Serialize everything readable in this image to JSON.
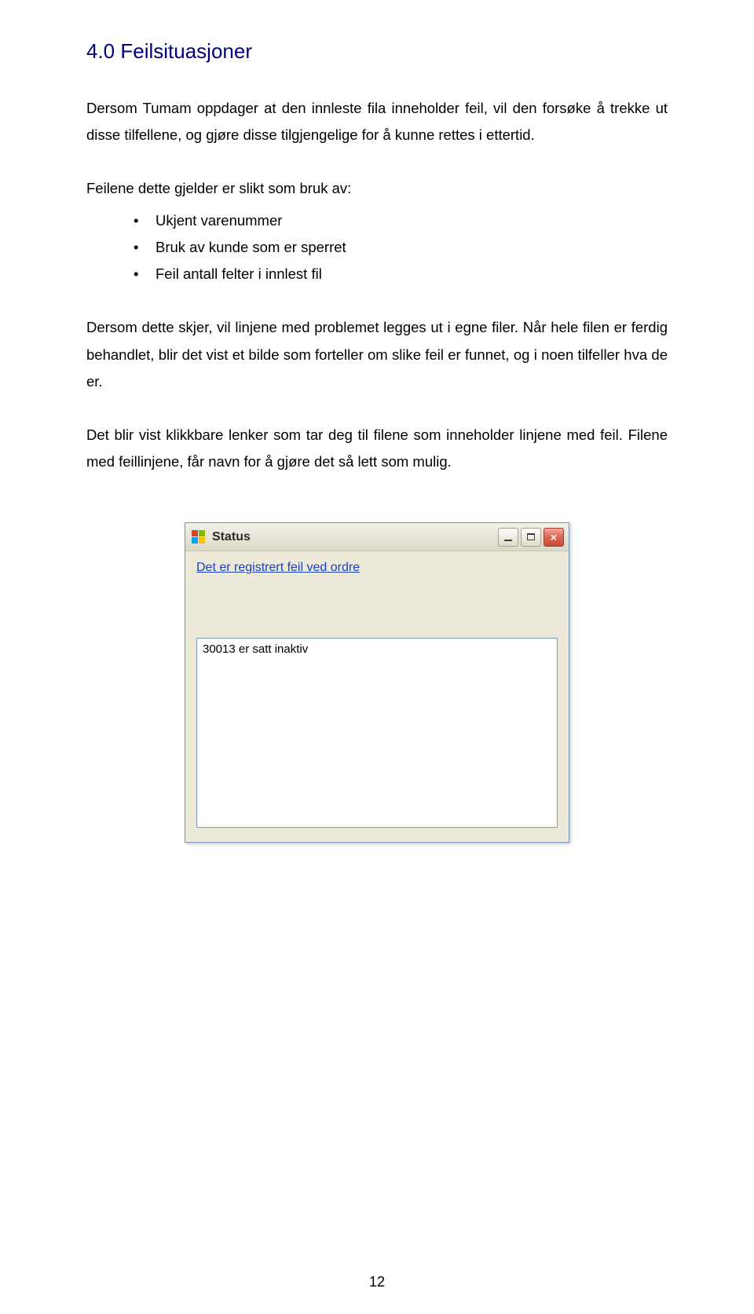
{
  "content": {
    "heading": "4.0 Feilsituasjoner",
    "para1": "Dersom Tumam oppdager at den innleste fila inneholder feil, vil den forsøke å trekke ut disse tilfellene, og gjøre disse tilgjengelige for å kunne rettes i ettertid.",
    "bullet_intro": "Feilene dette gjelder er slikt som bruk av:",
    "bullets": [
      "Ukjent varenummer",
      "Bruk av kunde som er sperret",
      "Feil antall felter i innlest fil"
    ],
    "para2": "Dersom dette skjer, vil linjene med problemet legges ut i egne filer. Når hele filen er ferdig behandlet, blir det vist et bilde som forteller om slike feil er funnet, og i noen tilfeller hva de er.",
    "para3": "Det blir vist klikkbare lenker som tar deg til filene som inneholder linjene med feil. Filene med feillinjene, får navn for å gjøre det så lett som mulig."
  },
  "dialog": {
    "title": "Status",
    "link_text": "Det er registrert feil ved ordre",
    "list_item": "30013 er satt inaktiv"
  },
  "page_number": "12"
}
